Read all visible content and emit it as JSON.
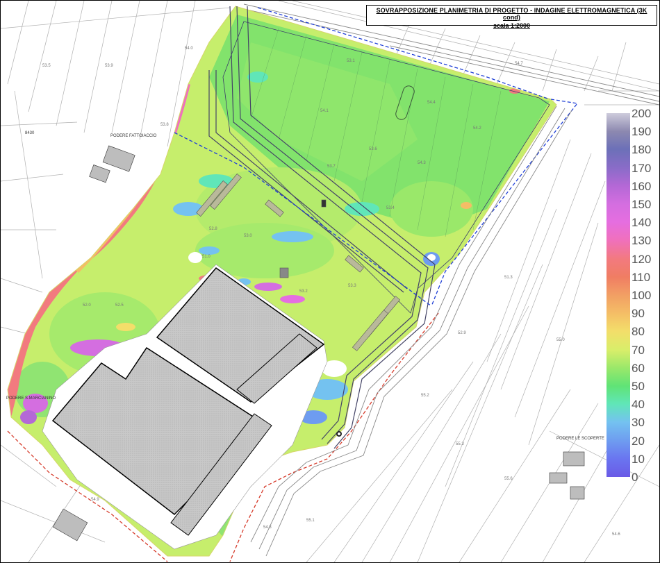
{
  "title": {
    "line1": "SOVRAPPOSIZIONE PLANIMETRIA DI PROGETTO - INDAGINE ELETTROMAGNETICA (3K cond)",
    "line2": "scala 1:2000"
  },
  "legend": {
    "labels": [
      "200",
      "190",
      "180",
      "170",
      "160",
      "150",
      "140",
      "130",
      "120",
      "110",
      "100",
      "90",
      "80",
      "70",
      "60",
      "50",
      "40",
      "30",
      "20",
      "10",
      "0"
    ],
    "colors": [
      "#ceccdc",
      "#8d89b0",
      "#6c70b8",
      "#8a6cc8",
      "#b468d6",
      "#d46ee0",
      "#e56ee0",
      "#f070bc",
      "#f27a7f",
      "#f07d63",
      "#f29f64",
      "#f4bd66",
      "#f3de6a",
      "#d9ee6a",
      "#9ae86a",
      "#60e376",
      "#60e6b8",
      "#74c2f0",
      "#6e9cf0",
      "#6a75f0",
      "#6a5ae6"
    ]
  },
  "places": {
    "podere_fattoiaccio": "PODERE FATTOIACCIO",
    "podere_san_marcianino": "PODERE S.MARCIANINO",
    "podere_scoperte": "PODERE LE SCOPERTE",
    "code_8430": "8430"
  },
  "parcel_numbers": [
    "53.5",
    "53.9",
    "53.8",
    "54.0",
    "54.1",
    "53.7",
    "53.6",
    "54.3",
    "54.2",
    "53.4",
    "53.2",
    "53.0",
    "52.8",
    "52.5",
    "52.0",
    "51.0",
    "51.3",
    "53.3",
    "52.9",
    "53.1",
    "54.4",
    "54.7",
    "55.0",
    "55.2",
    "55.3",
    "55.6",
    "55.1",
    "54.8",
    "54.9",
    "54.6"
  ],
  "colors": {
    "bg": "#ffffff",
    "survey_green": "#7ee86c",
    "survey_yellowgreen": "#c6ee6c",
    "building_gray": "#c4c4c4",
    "boundary_blue": "#1f3fd6",
    "boundary_red": "#d63a2a"
  }
}
